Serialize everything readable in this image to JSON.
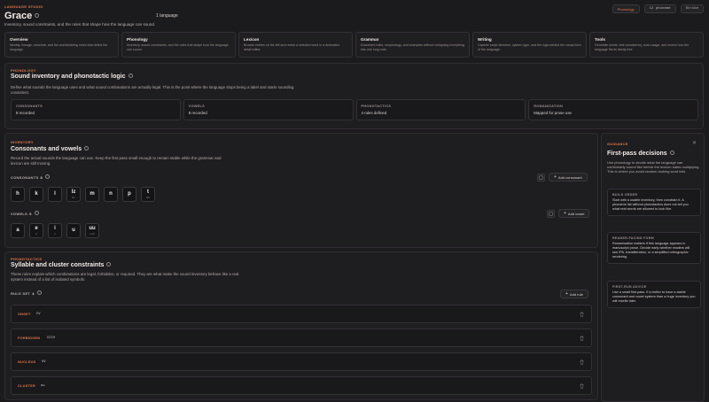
{
  "header": {
    "eyebrow": "LANGUAGE STUDIO",
    "title": "Grace",
    "count": "1 language",
    "tagline": "Inventory, sound constraints, and the rules that shape how the language can sound.",
    "actions": [
      "Phonology",
      "12 phoneme",
      "Strike"
    ]
  },
  "nav": [
    {
      "title": "Overview",
      "desc": "Identity, lineage, structure, and the worldbuilding notes that define the language."
    },
    {
      "title": "Phonology",
      "desc": "Inventory, sound constraints, and the rules that shape how the language can sound."
    },
    {
      "title": "Lexicon",
      "desc": "Browse entries on the left and revise a selected word in a dedicated detail editor."
    },
    {
      "title": "Grammar",
      "desc": "Document rules, morphology, and examples without collapsing everything into one long note."
    },
    {
      "title": "Writing",
      "desc": "Capture script direction, system type, and the logic behind the visual form of the language."
    },
    {
      "title": "Tools",
      "desc": "Generate words, test consistency, scan usage, and review how the language fits its family tree."
    }
  ],
  "phonology": {
    "eyebrow": "PHONOLOGY",
    "title": "Sound inventory and phonotactic logic",
    "desc": "Define what sounds the language uses and what sound combinations are actually legal. This is the point where the language stops being a label and starts sounding consistent.",
    "stats": [
      {
        "label": "CONSONANTS",
        "value": "8 recorded"
      },
      {
        "label": "VOWELS",
        "value": "8 recorded"
      },
      {
        "label": "PHONOTACTICS",
        "value": "4 rules defined"
      },
      {
        "label": "ROMANIZATION",
        "value": "Mapped for prose use"
      }
    ]
  },
  "inventory": {
    "eyebrow": "INVENTORY",
    "title": "Consonants and vowels",
    "desc": "Record the actual sounds the language can use. Keep the first pass small enough to remain stable while the grammar and lexicon are still moving.",
    "consonants_label": "CONSONANTS",
    "consonants_count": "8",
    "add_consonant": "Add consonant",
    "consonants": [
      {
        "g": "h",
        "r": ""
      },
      {
        "g": "k",
        "r": ""
      },
      {
        "g": "l",
        "r": ""
      },
      {
        "g": "lz",
        "r": "lzz"
      },
      {
        "g": "m",
        "r": ""
      },
      {
        "g": "n",
        "r": ""
      },
      {
        "g": "p",
        "r": ""
      },
      {
        "g": "t",
        "r": "tsh"
      }
    ],
    "vowels_label": "VOWELS",
    "vowels_count": "5",
    "add_vowel": "Add vowel",
    "vowels": [
      {
        "g": "a",
        "r": ""
      },
      {
        "g": "e",
        "r": "ê"
      },
      {
        "g": "i",
        "r": "ii"
      },
      {
        "g": "u",
        "r": ""
      },
      {
        "g": "uu",
        "r": "uuh"
      }
    ]
  },
  "phonotactics": {
    "eyebrow": "PHONOTACTICS",
    "title": "Syllable and cluster constraints",
    "desc": "These rules explain which combinations are legal, forbidden, or required. They are what make the sound inventory behave like a real system instead of a list of isolated symbols.",
    "ruleset_label": "RULE SET",
    "ruleset_count": "4",
    "add_rule": "Add rule",
    "rules": [
      {
        "name": "ONSET",
        "pattern": "CV"
      },
      {
        "name": "FORBIDDEN",
        "pattern": "CCCV"
      },
      {
        "name": "NUCLEUS",
        "pattern": "VV"
      },
      {
        "name": "CLUSTER",
        "pattern": "uu"
      }
    ]
  },
  "guidance": {
    "eyebrow": "GUIDANCE",
    "title": "First-pass decisions",
    "desc": "Use phonology to decide what the language can comfortably sound like before the lexicon starts multiplying. This is where you avoid random-looking word lists.",
    "cards": [
      {
        "title": "BUILD ORDER",
        "text": "Start with a usable inventory, then constrain it. A phoneme list without phonotactics does not tell you what real words are allowed to look like."
      },
      {
        "title": "READER-FACING FORM",
        "text": "Romanisation matters if this language appears in manuscript prose. Decide early whether readers will see IPA, transliteration, or a simplified orthographic rendering."
      },
      {
        "title": "FIRST-RUN ADVICE",
        "text": "Use a small first pass. It is better to have a stable consonant and vowel system than a huge inventory you will rewrite later."
      }
    ]
  },
  "colors": {
    "accent": "#e07a4a",
    "background": "#1b1a1d"
  }
}
